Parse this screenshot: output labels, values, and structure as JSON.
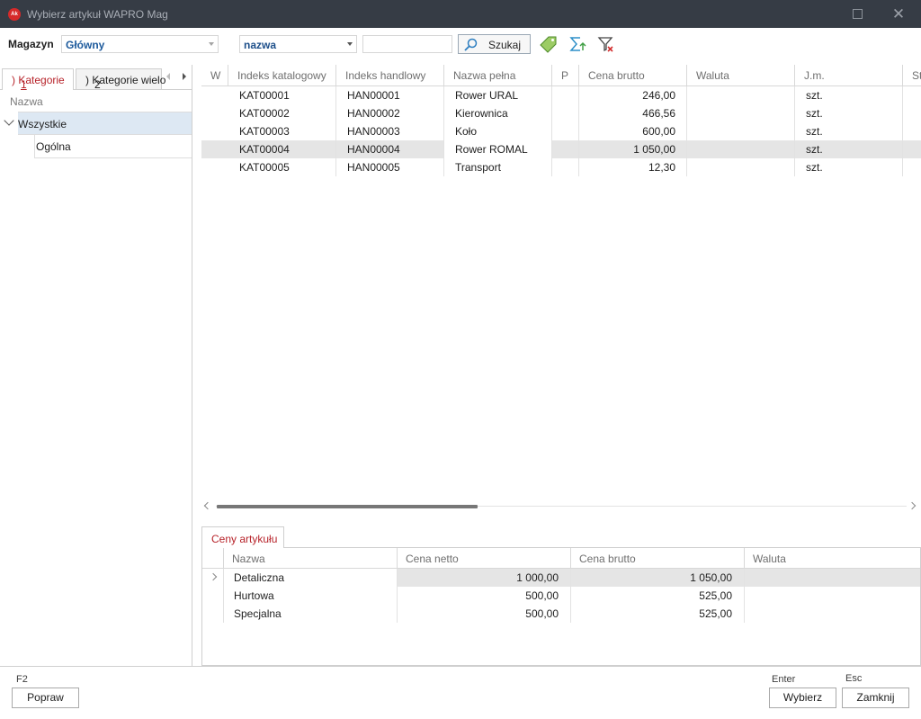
{
  "window": {
    "app_icon_text": "Ak",
    "title": "Wybierz artykuł WAPRO Mag"
  },
  "toolbar": {
    "magazyn_label": "Magazyn",
    "magazyn_value": "Główny",
    "search_field_value": "nazwa",
    "search_text": "",
    "search_button": "Szukaj",
    "icons": [
      "price-tag-icon",
      "sum-icon",
      "clear-filter-icon"
    ],
    "colors": {
      "tag": "#6ab04c",
      "sum": "#2d8fc8",
      "filter_x": "#d32f2f"
    }
  },
  "left_panel": {
    "tabs": [
      {
        "key": "1",
        "label": ") Kategorie"
      },
      {
        "key": "2",
        "label": ") Kategorie wielo"
      }
    ],
    "tree_header": "Nazwa",
    "tree": [
      {
        "label": "Wszystkie",
        "expanded": true,
        "selected": true
      },
      {
        "label": "Ogólna"
      }
    ]
  },
  "grid": {
    "columns": [
      "W",
      "Indeks katalogowy",
      "Indeks handlowy",
      "Nazwa pełna",
      "P",
      "Cena brutto",
      "Waluta",
      "J.m.",
      "St"
    ],
    "rows": [
      {
        "kat": "KAT00001",
        "han": "HAN00001",
        "nazwa": "Rower URAL",
        "cena": "246,00",
        "jm": "szt."
      },
      {
        "kat": "KAT00002",
        "han": "HAN00002",
        "nazwa": "Kierownica",
        "cena": "466,56",
        "jm": "szt."
      },
      {
        "kat": "KAT00003",
        "han": "HAN00003",
        "nazwa": "Koło",
        "cena": "600,00",
        "jm": "szt."
      },
      {
        "kat": "KAT00004",
        "han": "HAN00004",
        "nazwa": "Rower ROMAL",
        "cena": "1 050,00",
        "jm": "szt."
      },
      {
        "kat": "KAT00005",
        "han": "HAN00005",
        "nazwa": "Transport",
        "cena": "12,30",
        "jm": "szt."
      }
    ],
    "selected_row": 3
  },
  "prices": {
    "tab_label": "Ceny artykułu",
    "columns": [
      "Nazwa",
      "Cena netto",
      "Cena brutto",
      "Waluta"
    ],
    "rows": [
      {
        "nazwa": "Detaliczna",
        "netto": "1 000,00",
        "brutto": "1 050,00",
        "waluta": ""
      },
      {
        "nazwa": "Hurtowa",
        "netto": "500,00",
        "brutto": "525,00",
        "waluta": ""
      },
      {
        "nazwa": "Specjalna",
        "netto": "500,00",
        "brutto": "525,00",
        "waluta": ""
      }
    ]
  },
  "footer": {
    "popraw_key": "F2",
    "popraw_label": "Popraw",
    "wybierz_key": "Enter",
    "wybierz_label": "Wybierz",
    "zamknij_key": "Esc",
    "zamknij_label": "Zamknij"
  }
}
